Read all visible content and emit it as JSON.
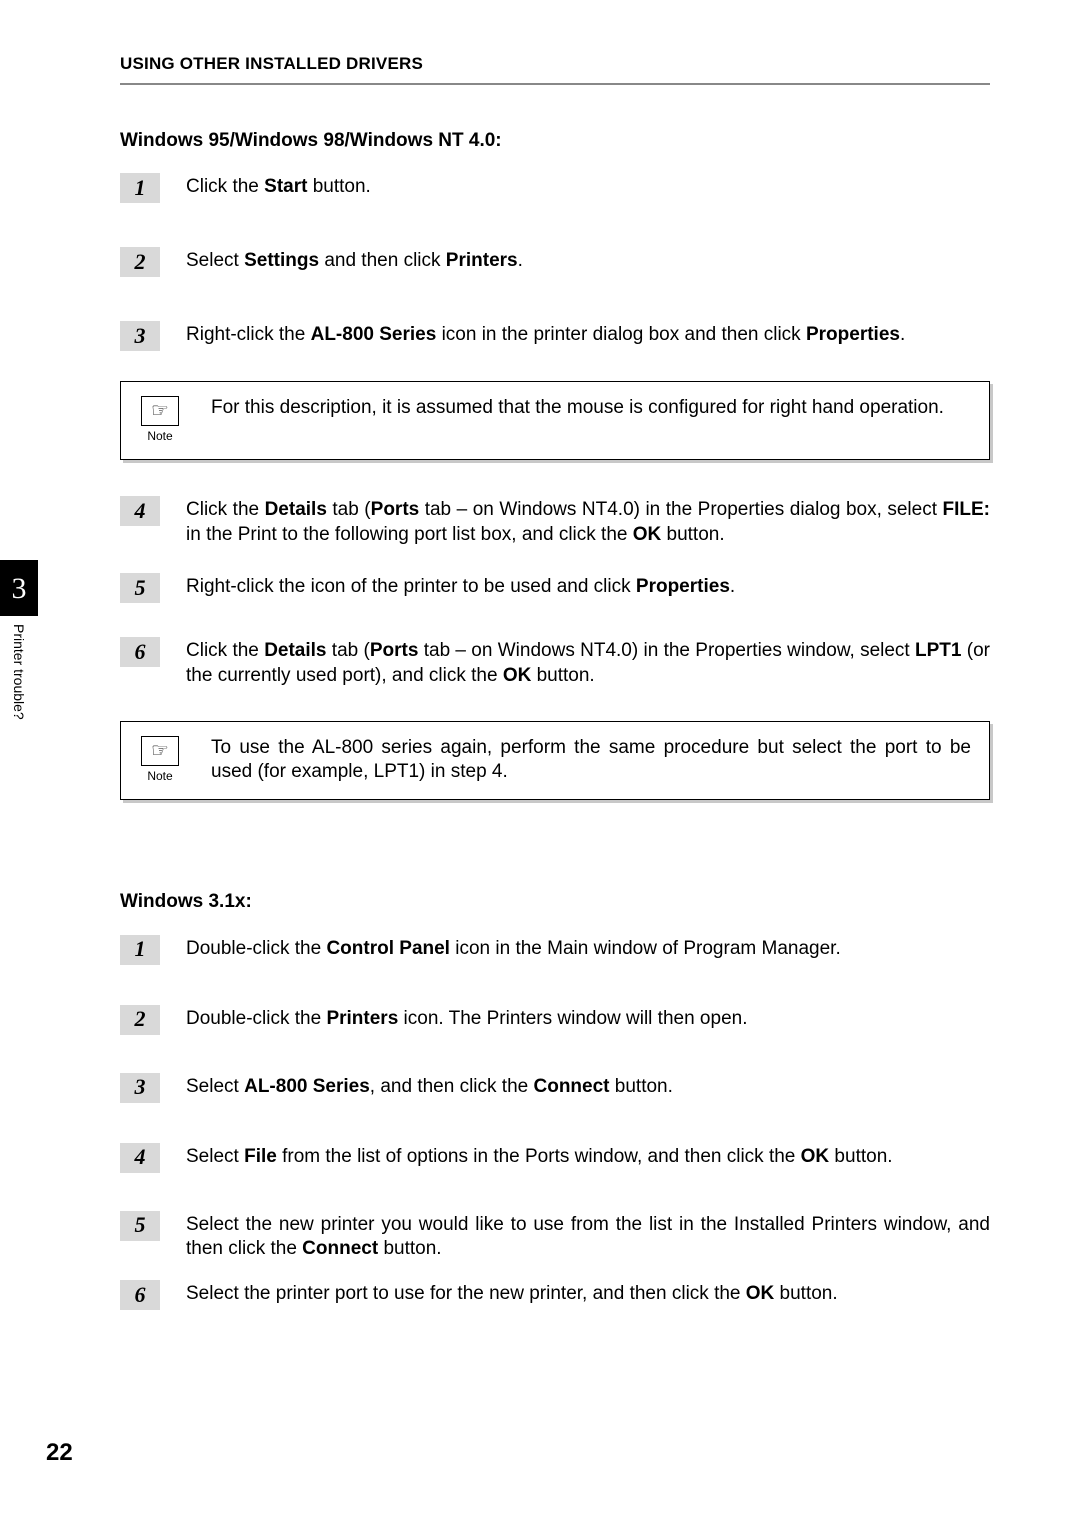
{
  "header": "USING OTHER INSTALLED DRIVERS",
  "sideTab": {
    "chapter": "3",
    "label": "Printer trouble?"
  },
  "pageNumber": "22",
  "section1": {
    "heading": "Windows 95/Windows 98/Windows NT 4.0:",
    "steps": [
      {
        "n": "1",
        "html": "Click the <b>Start</b> button."
      },
      {
        "n": "2",
        "html": "Select <b>Settings</b> and then click <b>Printers</b>."
      },
      {
        "n": "3",
        "html": "Right-click the <b>AL-800 Series</b> icon in the printer dialog box and then click <b>Properties</b>."
      }
    ],
    "note1": {
      "icon": "☞",
      "label": "Note",
      "text": "For this description, it is assumed that the mouse is configured for right hand operation."
    },
    "steps2": [
      {
        "n": "4",
        "html": "Click the <b>Details</b> tab (<b>Ports</b> tab – on Windows NT4.0) in the Properties dialog box, select <b>FILE:</b> in the Print to the following port list box, and click the <b>OK</b> button."
      },
      {
        "n": "5",
        "html": "Right-click the icon of the printer to be used and click <b>Properties</b>."
      },
      {
        "n": "6",
        "html": "Click the <b>Details</b> tab (<b>Ports</b> tab – on Windows NT4.0) in the Properties window, select <b>LPT1</b> (or the currently used port), and click the <b>OK</b> button."
      }
    ],
    "note2": {
      "icon": "☞",
      "label": "Note",
      "text": "To use the AL-800 series again, perform the same procedure but select the port to be used (for example, LPT1) in step 4."
    }
  },
  "section2": {
    "heading": "Windows 3.1x:",
    "steps": [
      {
        "n": "1",
        "html": "Double-click the <b>Control Panel</b> icon in the Main window of Program Manager."
      },
      {
        "n": "2",
        "html": "Double-click the <b>Printers</b> icon. The Printers window will then open."
      },
      {
        "n": "3",
        "html": "Select <b>AL-800 Series</b>, and then click the <b>Connect</b> button."
      },
      {
        "n": "4",
        "html": "Select <b>File</b> from the list of options in the Ports window, and then click the <b>OK</b> button."
      },
      {
        "n": "5",
        "html": "Select the new printer you would like to use from the list in the Installed Printers window, and then click the <b>Connect</b> button."
      },
      {
        "n": "6",
        "html": "Select the printer port to use for the new printer, and then click the <b>OK</b> button."
      }
    ]
  }
}
